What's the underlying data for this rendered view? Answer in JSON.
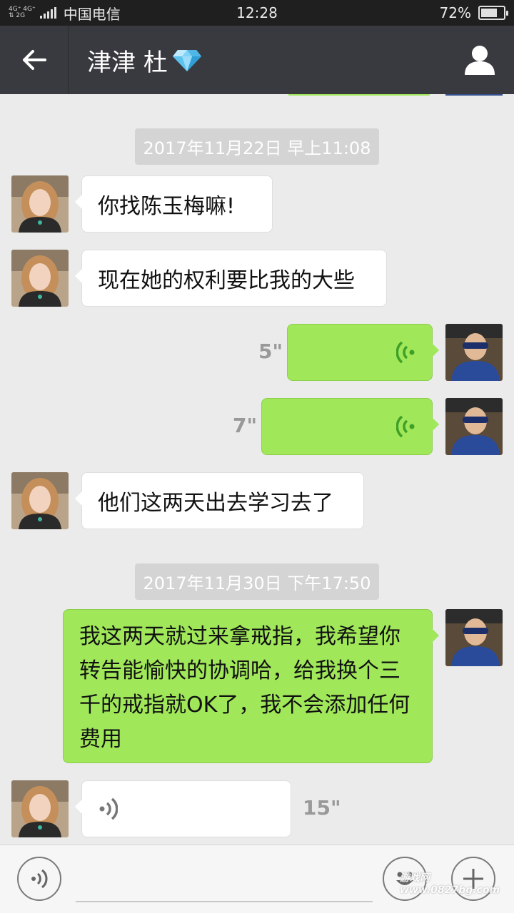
{
  "status_bar": {
    "network_top": "4G⁺ 4G⁺",
    "network_bottom": "⇅ 2G",
    "carrier": "中国电信",
    "time": "12:28",
    "battery": "72%",
    "battery_level": 0.72
  },
  "header": {
    "contact_name": "津津 杜"
  },
  "messages": [
    {
      "type": "timestamp",
      "text": "2017年11月22日 早上11:08"
    },
    {
      "type": "text",
      "side": "left",
      "text": "你找陈玉梅嘛!"
    },
    {
      "type": "text",
      "side": "left",
      "text": "现在她的权利要比我的大些"
    },
    {
      "type": "voice",
      "side": "right",
      "duration": "5\""
    },
    {
      "type": "voice",
      "side": "right",
      "duration": "7\""
    },
    {
      "type": "text",
      "side": "left",
      "text": "他们这两天出去学习去了"
    },
    {
      "type": "timestamp",
      "text": "2017年11月30日 下午17:50"
    },
    {
      "type": "text",
      "side": "right",
      "lines": [
        "我这两天就过来拿戒指，我希望你",
        "转告能愉快的协调哈，给我换个三",
        "千的戒指就OK了，我不会添加任何",
        "费用"
      ]
    },
    {
      "type": "voice",
      "side": "left",
      "duration": "15\""
    }
  ],
  "input_bar": {
    "watermark": "游戏网 www.0827bg.com"
  },
  "colors": {
    "title_bg": "#393a3f",
    "bubble_green": "#a0e75a",
    "chat_bg": "#ebebeb"
  }
}
